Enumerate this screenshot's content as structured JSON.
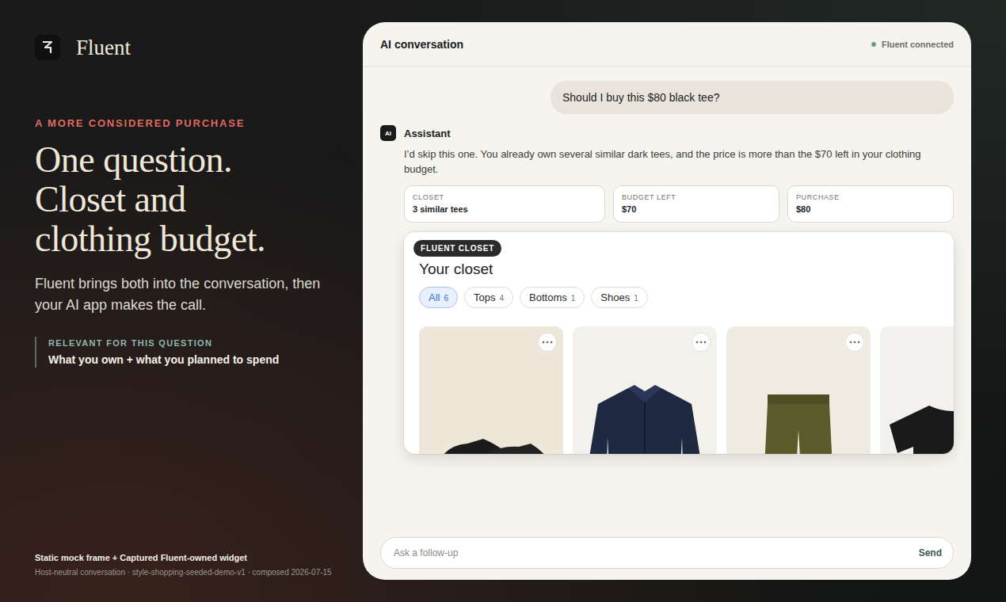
{
  "brand": {
    "name": "Fluent"
  },
  "hero": {
    "eyebrow": "A MORE CONSIDERED PURCHASE",
    "title_lines": [
      "One question.",
      "Closet and",
      "clothing budget."
    ],
    "body": "Fluent brings both into the conversation, then your AI app makes the call.",
    "relevance": {
      "label": "RELEVANT FOR THIS QUESTION",
      "value": "What you own + what you planned to spend"
    }
  },
  "footnote": {
    "title": "Static mock frame + Captured Fluent-owned widget",
    "meta": "Host-neutral conversation · style-shopping-seeded-demo-v1 · composed 2026-07-15"
  },
  "chat": {
    "title": "AI conversation",
    "status": "Fluent connected",
    "connected": true,
    "user_message": "Should I buy this $80 black tee?",
    "assistant": {
      "avatar": "AI",
      "name": "Assistant",
      "text": "I’d skip this one. You already own several similar dark tees, and the price is more than the $70 left in your clothing budget.",
      "stats": [
        {
          "label": "CLOSET",
          "value": "3 similar tees"
        },
        {
          "label": "BUDGET LEFT",
          "value": "$70"
        },
        {
          "label": "PURCHASE",
          "value": "$80"
        }
      ]
    },
    "widget": {
      "badge": "FLUENT CLOSET",
      "title": "Your closet",
      "filters": [
        {
          "label": "All",
          "count": "6",
          "selected": true
        },
        {
          "label": "Tops",
          "count": "4",
          "selected": false
        },
        {
          "label": "Bottoms",
          "count": "1",
          "selected": false
        },
        {
          "label": "Shoes",
          "count": "1",
          "selected": false
        }
      ],
      "items": [
        {
          "kind": "shoes"
        },
        {
          "kind": "shirt"
        },
        {
          "kind": "pants"
        },
        {
          "kind": "tee"
        }
      ]
    },
    "composer": {
      "placeholder": "Ask a follow-up",
      "send": "Send"
    }
  }
}
